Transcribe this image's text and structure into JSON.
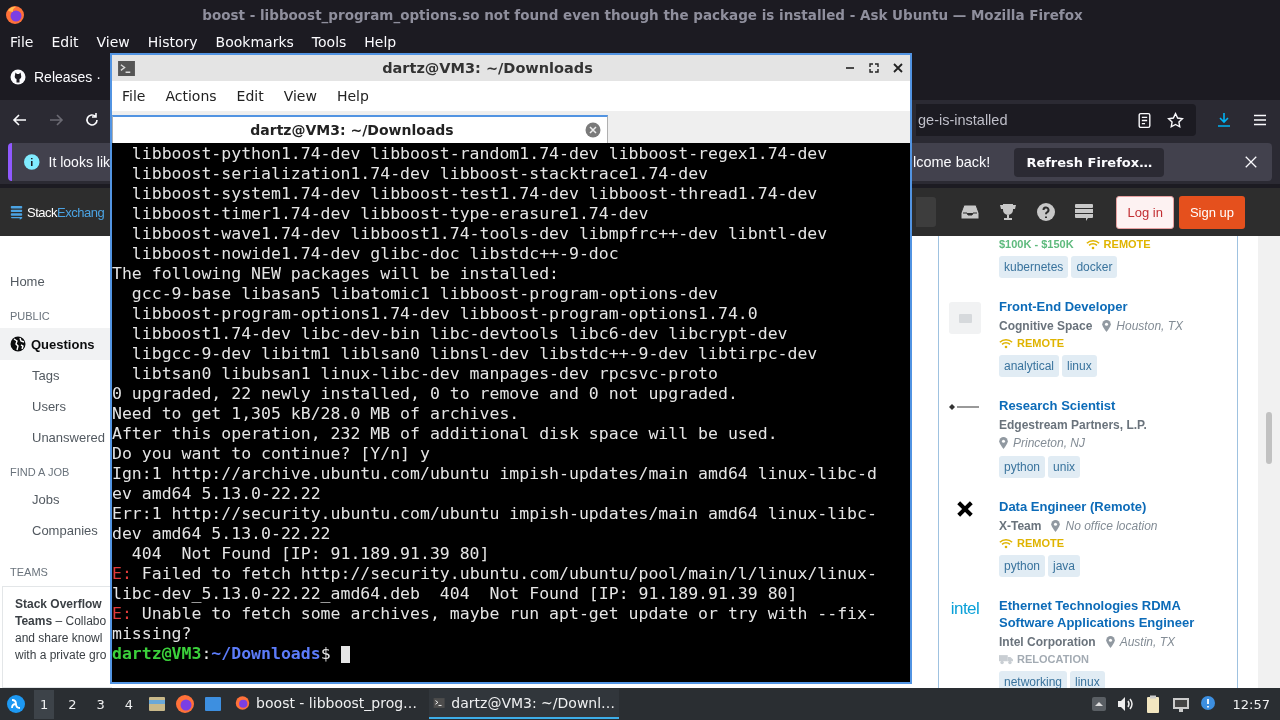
{
  "browser": {
    "title": "boost - libboost_program_options.so not found even though the package is installed - Ask Ubuntu — Mozilla Firefox",
    "menu": [
      "File",
      "Edit",
      "View",
      "History",
      "Bookmarks",
      "Tools",
      "Help"
    ],
    "tab": {
      "label": "Releases ·"
    },
    "nav": {
      "forward_disabled": true
    },
    "url_tail": "ge-is-installed",
    "notification": {
      "left_text": "It looks lik",
      "right_text": "lcome back!",
      "button": "Refresh Firefox…"
    }
  },
  "site_header": {
    "logo_first": "Stack",
    "logo_second": "Exchang",
    "login": "Log in",
    "signup": "Sign up"
  },
  "sidebar": {
    "sections": [
      {
        "items": [
          {
            "kind": "link",
            "label": "Home",
            "selected": false
          }
        ]
      },
      {
        "heading": "PUBLIC",
        "items": [
          {
            "kind": "icon-link",
            "label": "Questions",
            "selected": true
          },
          {
            "kind": "link",
            "label": "Tags",
            "selected": false
          },
          {
            "kind": "link",
            "label": "Users",
            "selected": false
          },
          {
            "kind": "link",
            "label": "Unanswered",
            "selected": false
          }
        ]
      },
      {
        "heading": "FIND A JOB",
        "items": [
          {
            "kind": "link",
            "label": "Jobs",
            "selected": false
          },
          {
            "kind": "link",
            "label": "Companies",
            "selected": false
          }
        ]
      }
    ],
    "teams": {
      "heading": "TEAMS",
      "lines": [
        "**Stack Overflow**",
        "**Teams** – Collabo",
        "and share knowl",
        "with a private gro"
      ]
    }
  },
  "jobs": [
    {
      "salary": "$100K - $150K",
      "perks": [
        {
          "kind": "remote",
          "label": "REMOTE"
        }
      ],
      "tags": [
        "kubernetes",
        "docker"
      ]
    },
    {
      "kind": "placeholder-logo",
      "title": "Front-End Developer",
      "company": "Cognitive Space",
      "location": "Houston, TX",
      "perks": [
        {
          "kind": "remote",
          "label": "REMOTE"
        }
      ],
      "tags": [
        "analytical",
        "linux"
      ]
    },
    {
      "kind": "diamond-logo",
      "title": "Research Scientist",
      "company": "Edgestream Partners, L.P.",
      "location": "Princeton, NJ",
      "tags": [
        "python",
        "unix"
      ]
    },
    {
      "kind": "cross-logo",
      "title": "Data Engineer (Remote)",
      "company": "X-Team",
      "location": "No office location",
      "perks": [
        {
          "kind": "remote",
          "label": "REMOTE"
        }
      ],
      "tags": [
        "python",
        "java"
      ]
    },
    {
      "kind": "wordmark-logo",
      "logo_text": "intel",
      "title": "Ethernet Technologies RDMA Software Applications Engineer",
      "company": "Intel Corporation",
      "location": "Austin, TX",
      "perks": [
        {
          "kind": "relocation",
          "label": "RELOCATION"
        }
      ],
      "tags": [
        "networking",
        "linux"
      ]
    }
  ],
  "terminal": {
    "title": "dartz@VM3: ~/Downloads",
    "menu": [
      "File",
      "Actions",
      "Edit",
      "View",
      "Help"
    ],
    "tab": {
      "label": "dartz@VM3: ~/Downloads"
    },
    "lines": [
      {
        "kind": "plain",
        "text": "  libboost-python1.74-dev libboost-random1.74-dev libboost-regex1.74-dev"
      },
      {
        "kind": "plain",
        "text": "  libboost-serialization1.74-dev libboost-stacktrace1.74-dev"
      },
      {
        "kind": "plain",
        "text": "  libboost-system1.74-dev libboost-test1.74-dev libboost-thread1.74-dev"
      },
      {
        "kind": "plain",
        "text": "  libboost-timer1.74-dev libboost-type-erasure1.74-dev"
      },
      {
        "kind": "plain",
        "text": "  libboost-wave1.74-dev libboost1.74-tools-dev libmpfrc++-dev libntl-dev"
      },
      {
        "kind": "plain",
        "text": "  libboost-nowide1.74-dev glibc-doc libstdc++-9-doc"
      },
      {
        "kind": "plain",
        "text": "The following NEW packages will be installed:"
      },
      {
        "kind": "plain",
        "text": "  gcc-9-base libasan5 libatomic1 libboost-program-options-dev"
      },
      {
        "kind": "plain",
        "text": "  libboost-program-options1.74-dev libboost-program-options1.74.0"
      },
      {
        "kind": "plain",
        "text": "  libboost1.74-dev libc-dev-bin libc-devtools libc6-dev libcrypt-dev"
      },
      {
        "kind": "plain",
        "text": "  libgcc-9-dev libitm1 liblsan0 libnsl-dev libstdc++-9-dev libtirpc-dev"
      },
      {
        "kind": "plain",
        "text": "  libtsan0 libubsan1 linux-libc-dev manpages-dev rpcsvc-proto"
      },
      {
        "kind": "plain",
        "text": "0 upgraded, 22 newly installed, 0 to remove and 0 not upgraded."
      },
      {
        "kind": "plain",
        "text": "Need to get 1,305 kB/28.0 MB of archives."
      },
      {
        "kind": "plain",
        "text": "After this operation, 232 MB of additional disk space will be used."
      },
      {
        "kind": "plain",
        "text": "Do you want to continue? [Y/n] y"
      },
      {
        "kind": "plain",
        "text": "Ign:1 http://archive.ubuntu.com/ubuntu impish-updates/main amd64 linux-libc-d"
      },
      {
        "kind": "plain",
        "text": "ev amd64 5.13.0-22.22"
      },
      {
        "kind": "plain",
        "text": "Err:1 http://security.ubuntu.com/ubuntu impish-updates/main amd64 linux-libc-"
      },
      {
        "kind": "plain",
        "text": "dev amd64 5.13.0-22.22"
      },
      {
        "kind": "plain",
        "text": "  404  Not Found [IP: 91.189.91.39 80]"
      },
      {
        "kind": "error",
        "tag": "E:",
        "text": " Failed to fetch http://security.ubuntu.com/ubuntu/pool/main/l/linux/linux-"
      },
      {
        "kind": "plain",
        "text": "libc-dev_5.13.0-22.22_amd64.deb  404  Not Found [IP: 91.189.91.39 80]"
      },
      {
        "kind": "error",
        "tag": "E:",
        "text": " Unable to fetch some archives, maybe run apt-get update or try with --fix-"
      },
      {
        "kind": "plain",
        "text": "missing?"
      },
      {
        "kind": "prompt",
        "user": "dartz@VM3",
        "separator": ":",
        "path": "~/Downloads",
        "symbol": "$"
      }
    ]
  },
  "taskbar": {
    "workspaces": [
      {
        "label": "1",
        "selected": true
      },
      {
        "label": "2",
        "selected": false
      },
      {
        "label": "3",
        "selected": false
      },
      {
        "label": "4",
        "selected": false
      }
    ],
    "tasks": [
      {
        "kind": "firefox",
        "label": "boost - libboost_prog…",
        "selected": false
      },
      {
        "kind": "terminal",
        "label": "dartz@VM3: ~/Downl…",
        "selected": true
      }
    ],
    "clock": "12:57"
  }
}
